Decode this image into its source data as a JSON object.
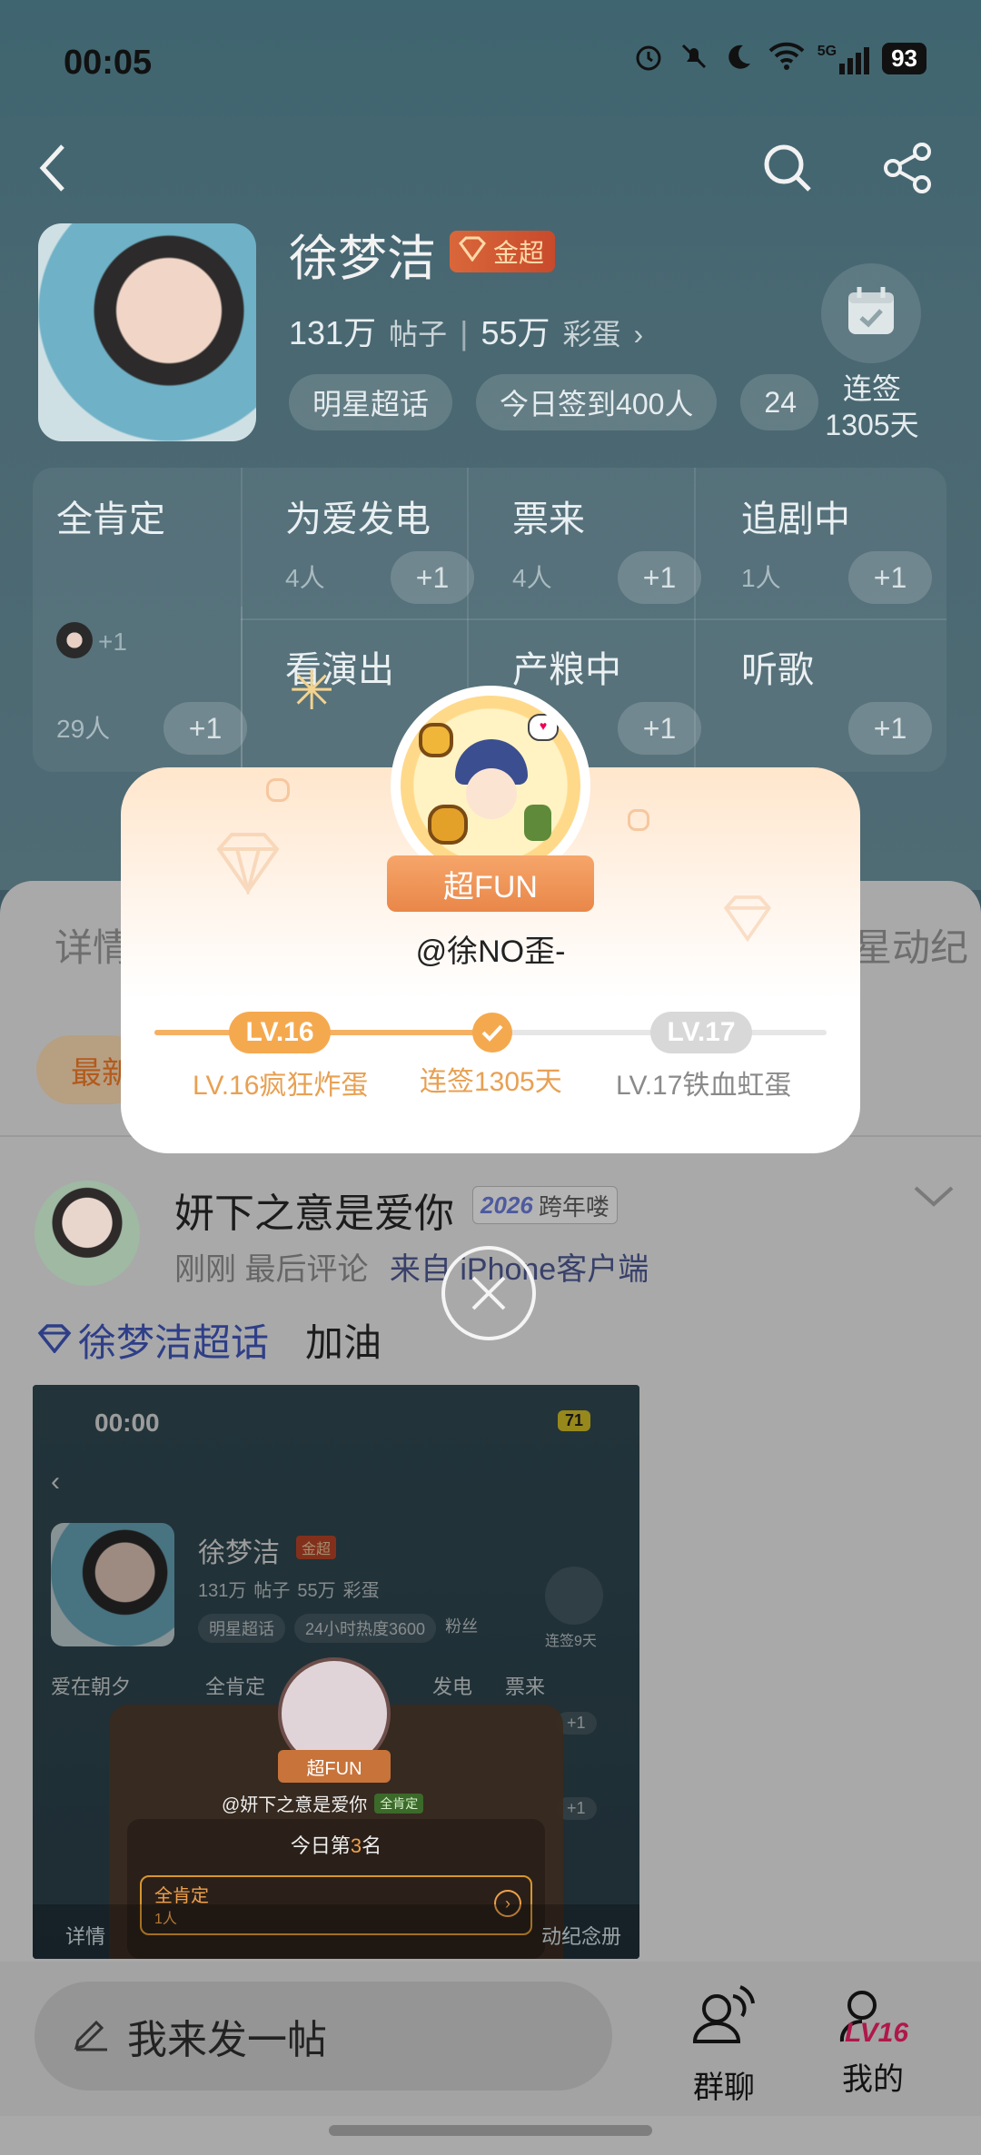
{
  "status_bar": {
    "time": "00:05",
    "battery": "93",
    "network": "5G"
  },
  "header": {
    "title": "徐梦洁",
    "badge": "金超",
    "posts_count": "131万",
    "posts_label": "帖子",
    "eggs_count": "55万",
    "eggs_label": "彩蛋",
    "chips": [
      "明星超话",
      "今日签到400人",
      "24"
    ],
    "checkin_label": "连签",
    "checkin_days": "1305天"
  },
  "reactions": {
    "first": {
      "name": "全肯定",
      "avatar_plus": "+1",
      "count": "29人",
      "plus": "+1"
    },
    "items": [
      {
        "name": "为爱发电",
        "count": "4人",
        "plus": "+1"
      },
      {
        "name": "票来",
        "count": "4人",
        "plus": "+1"
      },
      {
        "name": "追剧中",
        "count": "1人",
        "plus": "+1"
      },
      {
        "name": "看演出",
        "count": "",
        "plus": ""
      },
      {
        "name": "产粮中",
        "count": "",
        "plus": "+1"
      },
      {
        "name": "听歌",
        "count": "",
        "plus": "+1"
      }
    ]
  },
  "sheet": {
    "tab_left": "详情",
    "tab_right": "星动纪",
    "latest_pill": "最新"
  },
  "modal": {
    "ribbon": "超FUN",
    "handle": "@徐NO歪-",
    "current_level": "LV.16",
    "current_level_label": "LV.16疯狂炸蛋",
    "streak_label": "连签1305天",
    "next_level": "LV.17",
    "next_level_label": "LV.17铁血虹蛋",
    "progress": 0.5
  },
  "post": {
    "username": "妍下之意是爱你",
    "year_badge_num": "2026",
    "year_badge": "跨年喽",
    "meta": "刚刚 最后评论",
    "source": "来自 iPhone客户端",
    "topic": "徐梦洁超话",
    "text": "加油"
  },
  "embedded": {
    "time": "00:00",
    "battery": "71",
    "title": "徐梦洁",
    "badge": "金超",
    "posts": "131万",
    "posts_label": "帖子",
    "eggs": "55万",
    "eggs_label": "彩蛋",
    "chip1": "明星超话",
    "chip2": "24小时热度3600",
    "chip3": "粉丝",
    "checkin": "连签9天",
    "cell1": "爱在朝夕",
    "cell2": "全肯定",
    "cell3": "发电",
    "cell4": "票来",
    "plus": "+1",
    "ribbon": "超FUN",
    "handle": "@妍下之意是爱你",
    "affirm": "全肯定",
    "rank_prefix": "今日第",
    "rank_num": "3",
    "rank_suffix": "名",
    "card_title": "全肯定",
    "card_count": "1人",
    "tab_left": "详情",
    "tab_right": "动纪念册"
  },
  "bottom_bar": {
    "compose": "我来发一帖",
    "group_chat": "群聊",
    "mine": "我的",
    "mine_level": "LV16"
  }
}
